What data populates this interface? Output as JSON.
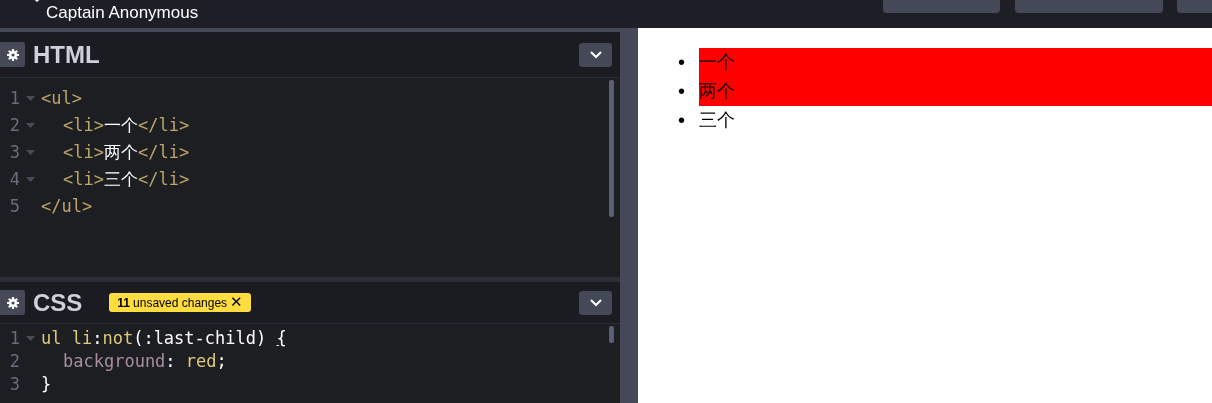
{
  "header": {
    "user": "Captain Anonymous"
  },
  "editors": [
    {
      "title": "HTML",
      "lines": [
        {
          "number": "1",
          "foldable": true,
          "indent": false,
          "tokens": [
            {
              "kind": "tag",
              "text": "<ul>"
            }
          ]
        },
        {
          "number": "2",
          "foldable": true,
          "indent": true,
          "tokens": [
            {
              "kind": "tag",
              "text": "<li>"
            },
            {
              "kind": "text",
              "text": "一个"
            },
            {
              "kind": "tag",
              "text": "</li>"
            }
          ]
        },
        {
          "number": "3",
          "foldable": true,
          "indent": true,
          "tokens": [
            {
              "kind": "tag",
              "text": "<li>"
            },
            {
              "kind": "text",
              "text": "两个"
            },
            {
              "kind": "tag",
              "text": "</li>"
            }
          ]
        },
        {
          "number": "4",
          "foldable": true,
          "indent": true,
          "tokens": [
            {
              "kind": "tag",
              "text": "<li>"
            },
            {
              "kind": "text",
              "text": "三个"
            },
            {
              "kind": "tag",
              "text": "</li>"
            }
          ]
        },
        {
          "number": "5",
          "foldable": false,
          "indent": false,
          "tokens": [
            {
              "kind": "tag",
              "text": "</ul>"
            }
          ]
        }
      ]
    },
    {
      "title": "CSS",
      "badge": {
        "count": "11",
        "text": "unsaved changes",
        "close": "✕"
      },
      "lines": [
        {
          "number": "1",
          "foldable": true,
          "indent": false,
          "tokens": [
            {
              "kind": "keyword",
              "text": "ul li"
            },
            {
              "kind": "text",
              "text": ":"
            },
            {
              "kind": "keyword",
              "text": "not"
            },
            {
              "kind": "text",
              "text": "(:last-child) "
            },
            {
              "kind": "bracket",
              "text": "{"
            }
          ]
        },
        {
          "number": "2",
          "foldable": false,
          "indent": true,
          "tokens": [
            {
              "kind": "property",
              "text": "background"
            },
            {
              "kind": "text",
              "text": ": "
            },
            {
              "kind": "keyword",
              "text": "red"
            },
            {
              "kind": "text",
              "text": ";"
            }
          ]
        },
        {
          "number": "3",
          "foldable": false,
          "indent": false,
          "tokens": [
            {
              "kind": "text",
              "text": "}"
            }
          ]
        }
      ]
    }
  ],
  "preview": {
    "items": [
      {
        "marker": "•",
        "text": "一个",
        "highlighted": true
      },
      {
        "marker": "•",
        "text": "两个",
        "highlighted": true
      },
      {
        "marker": "•",
        "text": "三个",
        "highlighted": false
      }
    ]
  }
}
